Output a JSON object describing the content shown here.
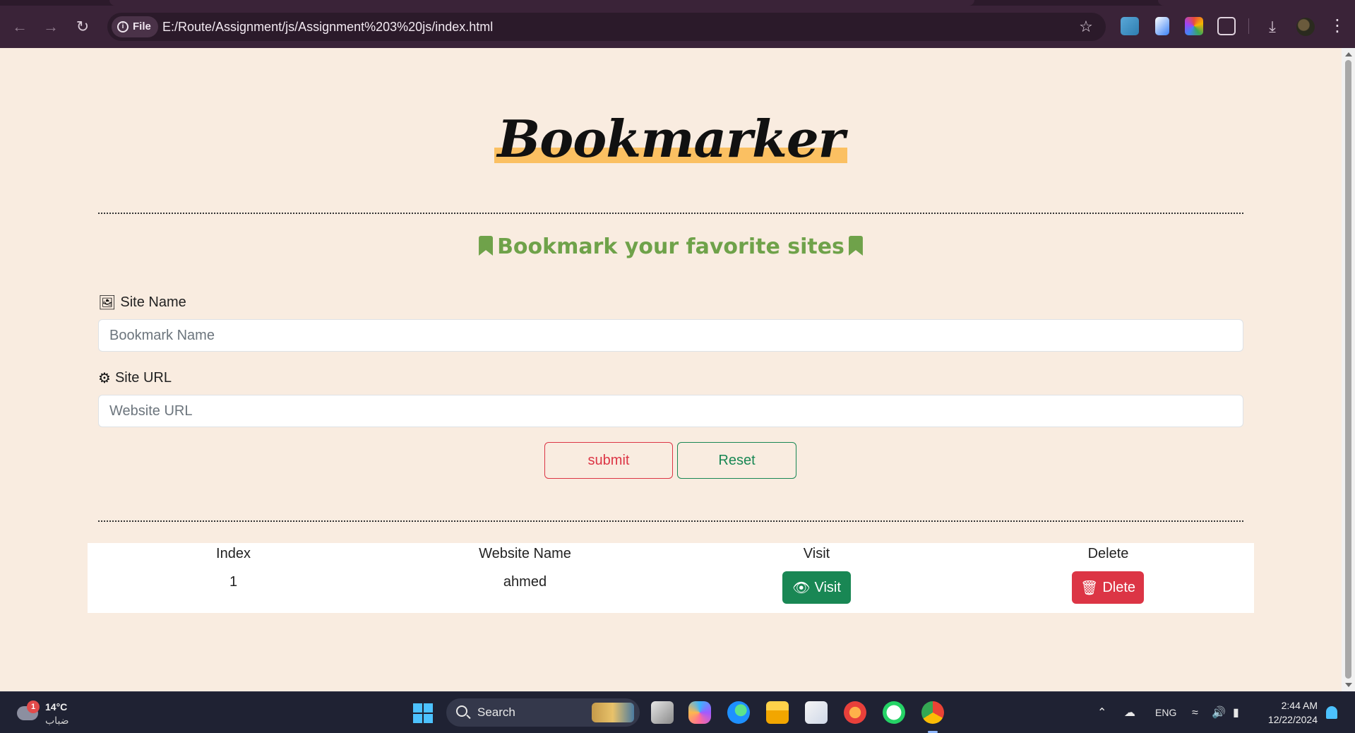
{
  "browser": {
    "site_chip": "File",
    "url": "E:/Route/Assignment/js/Assignment%203%20js/index.html"
  },
  "page": {
    "title": "Bookmarker",
    "subtitle": "Bookmark your favorite sites",
    "site_name_label": "Site Name",
    "site_name_placeholder": "Bookmark Name",
    "site_url_label": "Site URL",
    "site_url_placeholder": "Website URL",
    "submit_label": "submit",
    "reset_label": "Reset",
    "colors": {
      "title_highlight": "#fbc062",
      "subtitle": "#6fa24a",
      "danger": "#dc3545",
      "success": "#198754",
      "background": "#f9ece0"
    }
  },
  "table": {
    "headers": [
      "Index",
      "Website Name",
      "Visit",
      "Delete"
    ],
    "rows": [
      {
        "index": "1",
        "name": "ahmed",
        "visit_label": "Visit",
        "delete_label": "Dlete"
      }
    ]
  },
  "taskbar": {
    "weather_badge": "1",
    "temperature": "14°C",
    "condition": "ضباب",
    "search_label": "Search",
    "language": "ENG",
    "time": "2:44 AM",
    "date": "12/22/2024"
  }
}
